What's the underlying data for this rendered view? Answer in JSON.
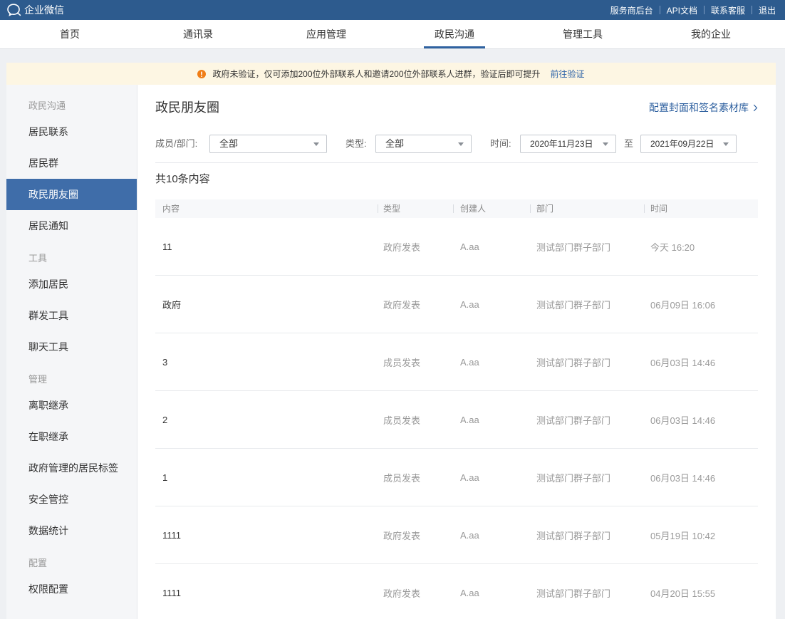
{
  "topbar": {
    "brand": "企业微信",
    "links": {
      "service_provider": "服务商后台",
      "api_docs": "API文档",
      "support": "联系客服",
      "logout": "退出"
    }
  },
  "nav": {
    "tabs": [
      {
        "label": "首页",
        "active": false
      },
      {
        "label": "通讯录",
        "active": false
      },
      {
        "label": "应用管理",
        "active": false
      },
      {
        "label": "政民沟通",
        "active": true
      },
      {
        "label": "管理工具",
        "active": false
      },
      {
        "label": "我的企业",
        "active": false
      }
    ]
  },
  "notice": {
    "text": "政府未验证，仅可添加200位外部联系人和邀请200位外部联系人进群，验证后即可提升",
    "link": "前往验证"
  },
  "sidebar": {
    "sections": [
      {
        "heading": "政民沟通",
        "items": [
          {
            "label": "居民联系",
            "active": false
          },
          {
            "label": "居民群",
            "active": false
          },
          {
            "label": "政民朋友圈",
            "active": true
          },
          {
            "label": "居民通知",
            "active": false
          }
        ]
      },
      {
        "heading": "工具",
        "items": [
          {
            "label": "添加居民",
            "active": false
          },
          {
            "label": "群发工具",
            "active": false
          },
          {
            "label": "聊天工具",
            "active": false
          }
        ]
      },
      {
        "heading": "管理",
        "items": [
          {
            "label": "离职继承",
            "active": false
          },
          {
            "label": "在职继承",
            "active": false
          },
          {
            "label": "政府管理的居民标签",
            "active": false
          },
          {
            "label": "安全管控",
            "active": false
          },
          {
            "label": "数据统计",
            "active": false
          }
        ]
      },
      {
        "heading": "配置",
        "items": [
          {
            "label": "权限配置",
            "active": false
          }
        ]
      }
    ]
  },
  "main": {
    "title": "政民朋友圈",
    "config_link": "配置封面和签名素材库",
    "filters": {
      "member": {
        "label": "成员/部门:",
        "value": "全部"
      },
      "type": {
        "label": "类型:",
        "value": "全部"
      },
      "time": {
        "label": "时间:",
        "start": "2020年11月23日",
        "separator": "至",
        "end": "2021年09月22日"
      }
    },
    "count": "共10条内容",
    "table": {
      "columns": [
        "内容",
        "类型",
        "创建人",
        "部门",
        "时间"
      ],
      "rows": [
        {
          "content": "11",
          "type": "政府发表",
          "creator": "A.aa",
          "department": "测试部门群子部门",
          "time": "今天 16:20"
        },
        {
          "content": "政府",
          "type": "政府发表",
          "creator": "A.aa",
          "department": "测试部门群子部门",
          "time": "06月09日 16:06"
        },
        {
          "content": "3",
          "type": "成员发表",
          "creator": "A.aa",
          "department": "测试部门群子部门",
          "time": "06月03日 14:46"
        },
        {
          "content": "2",
          "type": "成员发表",
          "creator": "A.aa",
          "department": "测试部门群子部门",
          "time": "06月03日 14:46"
        },
        {
          "content": "1",
          "type": "成员发表",
          "creator": "A.aa",
          "department": "测试部门群子部门",
          "time": "06月03日 14:46"
        },
        {
          "content": "1111",
          "type": "政府发表",
          "creator": "A.aa",
          "department": "测试部门群子部门",
          "time": "05月19日 10:42"
        },
        {
          "content": "1111",
          "type": "政府发表",
          "creator": "A.aa",
          "department": "测试部门群子部门",
          "time": "04月20日 15:55"
        }
      ]
    }
  },
  "icons": {
    "brand": "wecom-logo-icon",
    "notice": "warning-icon",
    "config_link": "chevron-right-icon",
    "select": "caret-down-icon"
  },
  "colors": {
    "topbar": "#2d5b8e",
    "active": "#3f6da9",
    "link": "#2b5e9e",
    "notice_bg": "#fdf6e3",
    "warning": "#f07d16"
  }
}
